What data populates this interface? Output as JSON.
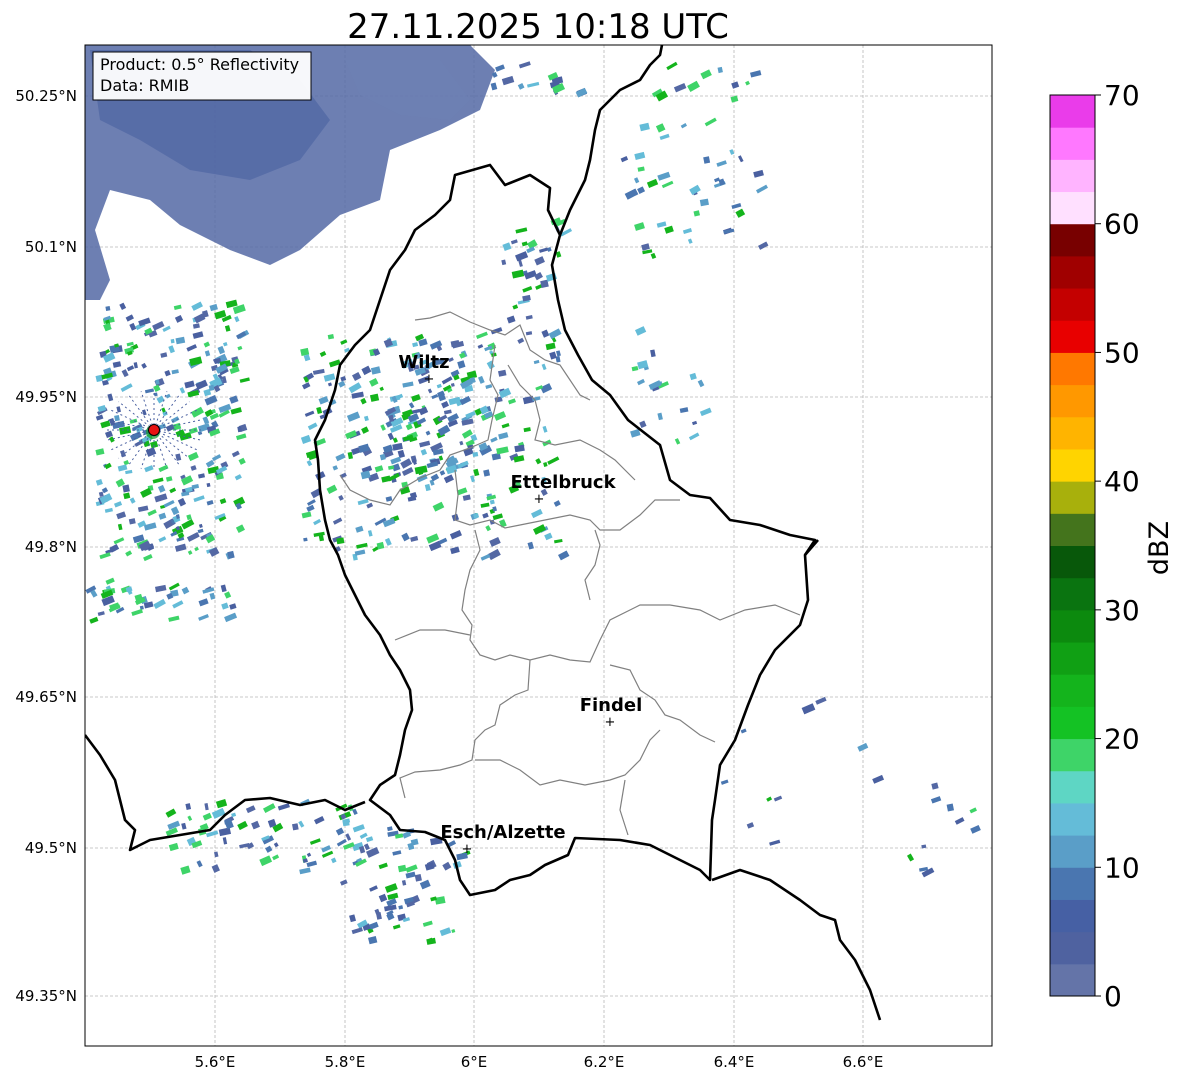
{
  "title": "27.11.2025 10:18 UTC",
  "info_box": {
    "product": "Product: 0.5° Reflectivity",
    "data": "Data: RMIB"
  },
  "lat_ticks": [
    "50.25°N",
    "50.1°N",
    "49.95°N",
    "49.8°N",
    "49.65°N",
    "49.5°N",
    "49.35°N"
  ],
  "lon_ticks": [
    "5.6°E",
    "5.8°E",
    "6°E",
    "6.2°E",
    "6.4°E",
    "6.6°E"
  ],
  "colorbar": {
    "label": "dBZ",
    "ticks": [
      "0",
      "10",
      "20",
      "30",
      "40",
      "50",
      "60",
      "70"
    ],
    "colors": [
      "#6474a8",
      "#4f62a0",
      "#4660a4",
      "#4a76b0",
      "#5a9ec8",
      "#64bcd8",
      "#5ed6c4",
      "#3ed468",
      "#14c224",
      "#14b41c",
      "#10a014",
      "#0c8a0e",
      "#0a7410",
      "#08580a",
      "#44741c",
      "#a8b00c",
      "#ffd400",
      "#ffb400",
      "#ff9800",
      "#ff7800",
      "#e80000",
      "#c40000",
      "#a00000",
      "#780000",
      "#ffe0ff",
      "#ffb4ff",
      "#ff78ff",
      "#ea3cea"
    ]
  },
  "cities": [
    {
      "name": "Wiltz"
    },
    {
      "name": "Ettelbruck"
    },
    {
      "name": "Findel"
    },
    {
      "name": "Esch/Alzette"
    }
  ],
  "radar_site_color": "#e81414"
}
